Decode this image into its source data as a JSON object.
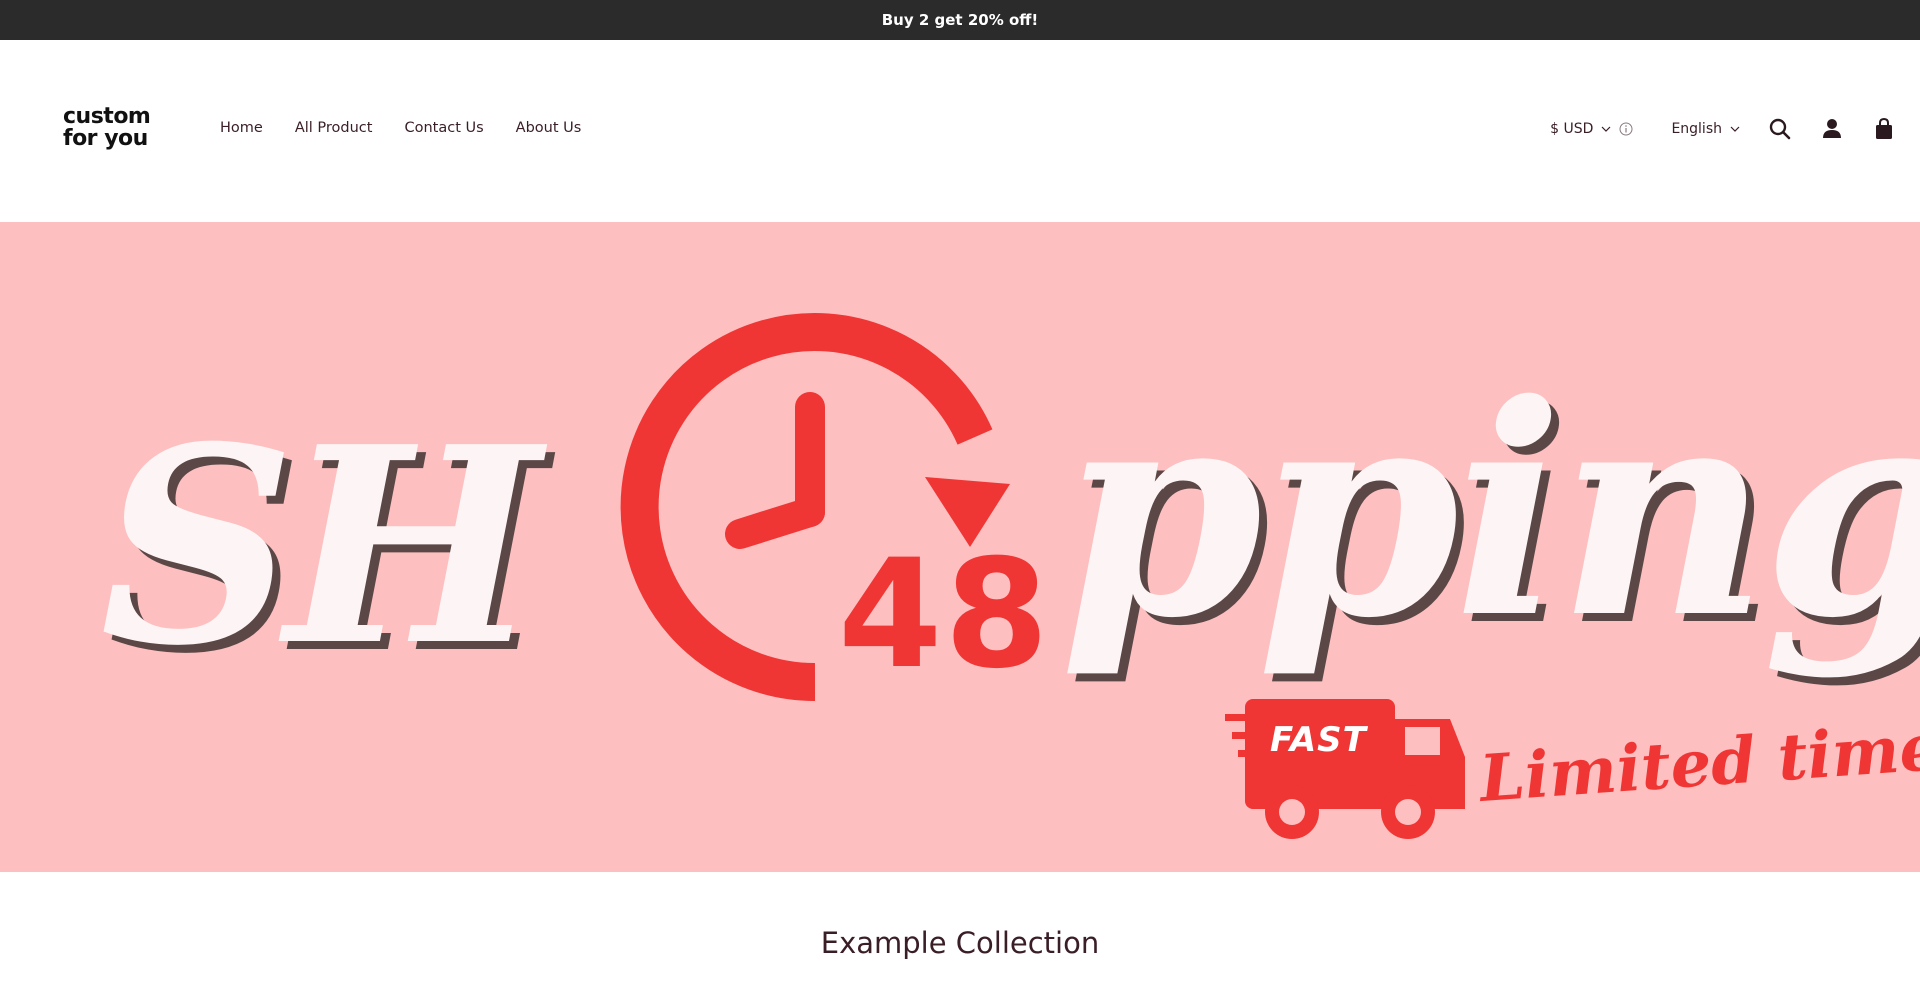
{
  "announcement": {
    "text": "Buy 2 get 20% off!"
  },
  "header": {
    "logo": {
      "line1": "custom",
      "line2": "for you"
    },
    "nav": [
      {
        "label": "Home"
      },
      {
        "label": "All Product"
      },
      {
        "label": "Contact Us"
      },
      {
        "label": "About Us"
      }
    ],
    "currency": {
      "value": "$ USD"
    },
    "language": {
      "value": "English"
    },
    "icons": [
      "search-icon",
      "account-icon",
      "cart-icon"
    ]
  },
  "hero": {
    "banner_text_left": "SH",
    "banner_text_right": "pping",
    "banner_number": "48",
    "truck_label": "FAST",
    "tagline": "Limited time",
    "colors": {
      "background": "#fdbfbf",
      "accent": "#f03535",
      "lettering": "#fdf5f5"
    }
  },
  "collection": {
    "title": "Example Collection"
  },
  "colors": {
    "announcement_bg": "#2b2b2b",
    "text": "#3a1e26"
  }
}
